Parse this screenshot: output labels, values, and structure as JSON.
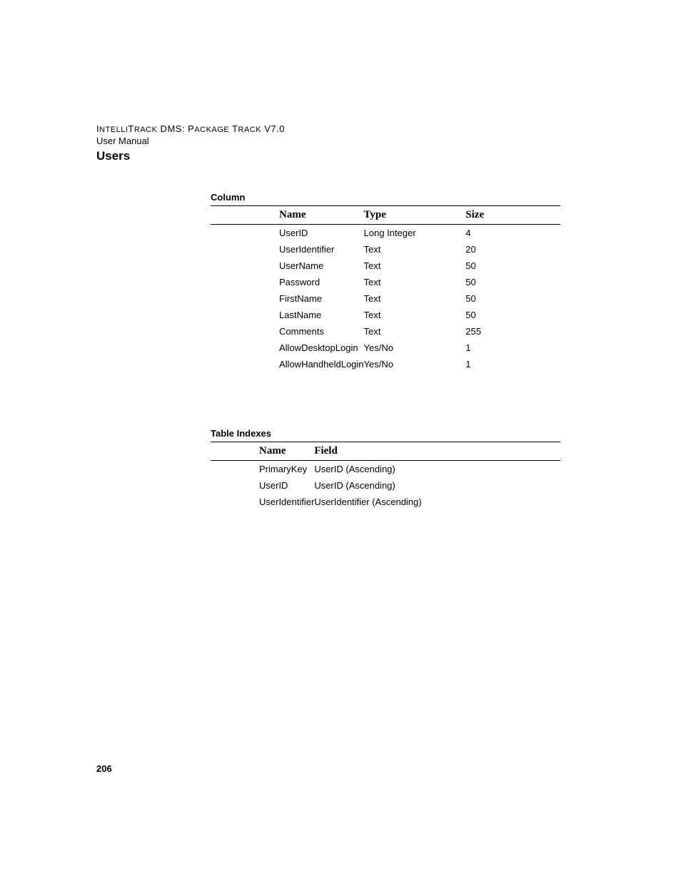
{
  "header": {
    "line1_part1": "I",
    "line1_part2": "NTELLI",
    "line1_part3": "T",
    "line1_part4": "RACK",
    "line1_part5": " DMS: P",
    "line1_part6": "ACKAGE",
    "line1_part7": " T",
    "line1_part8": "RACK",
    "line1_part9": " V",
    "line1_part10": "7.0",
    "line2": "User Manual"
  },
  "sectionTitle": "Users",
  "columnLabel": "Column",
  "columnTable": {
    "headers": {
      "name": "Name",
      "type": "Type",
      "size": "Size"
    },
    "rows": [
      {
        "name": "UserID",
        "type": "Long Integer",
        "size": "4"
      },
      {
        "name": "UserIdentifier",
        "type": "Text",
        "size": "20"
      },
      {
        "name": "UserName",
        "type": "Text",
        "size": "50"
      },
      {
        "name": "Password",
        "type": "Text",
        "size": "50"
      },
      {
        "name": "FirstName",
        "type": "Text",
        "size": "50"
      },
      {
        "name": "LastName",
        "type": "Text",
        "size": "50"
      },
      {
        "name": "Comments",
        "type": "Text",
        "size": "255"
      },
      {
        "name": "AllowDesktopLogin",
        "type": "Yes/No",
        "size": "1"
      },
      {
        "name": "AllowHandheldLogin",
        "type": "Yes/No",
        "size": "1"
      }
    ]
  },
  "indexLabel": "Table Indexes",
  "indexTable": {
    "headers": {
      "name": "Name",
      "field": "Field"
    },
    "rows": [
      {
        "name": "PrimaryKey",
        "field": "UserID (Ascending)"
      },
      {
        "name": "UserID",
        "field": "UserID (Ascending)"
      },
      {
        "name": "UserIdentifier",
        "field": "UserIdentifier (Ascending)"
      }
    ]
  },
  "pageNumber": "206"
}
